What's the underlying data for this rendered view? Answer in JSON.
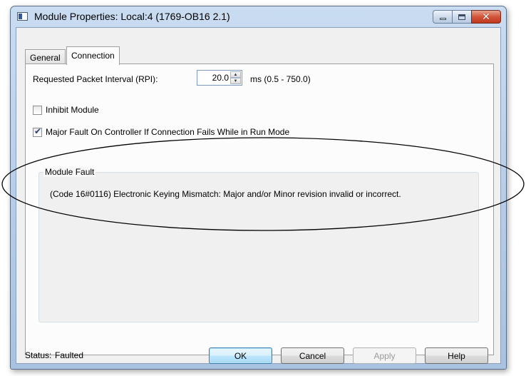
{
  "window": {
    "title": "Module Properties: Local:4 (1769-OB16 2.1)"
  },
  "tabs": [
    {
      "label": "General",
      "active": false
    },
    {
      "label": "Connection",
      "active": true
    }
  ],
  "connection": {
    "rpi_label": "Requested Packet Interval (RPI):",
    "rpi_value": "20.0",
    "rpi_unit": "ms (0.5 - 750.0)",
    "inhibit_label": "Inhibit Module",
    "inhibit_checked": false,
    "major_fault_label": "Major Fault On Controller If Connection Fails While in Run Mode",
    "major_fault_checked": true
  },
  "module_fault": {
    "legend": "Module Fault",
    "message": "(Code 16#0116) Electronic Keying Mismatch: Major and/or Minor revision invalid or incorrect."
  },
  "status": {
    "label": "Status:",
    "value": "Faulted"
  },
  "buttons": {
    "ok": "OK",
    "cancel": "Cancel",
    "apply": "Apply",
    "help": "Help"
  },
  "colors": {
    "title_bar": "#b5cbe5",
    "close_button": "#c0391f",
    "annotation_ellipse": "#000000"
  }
}
